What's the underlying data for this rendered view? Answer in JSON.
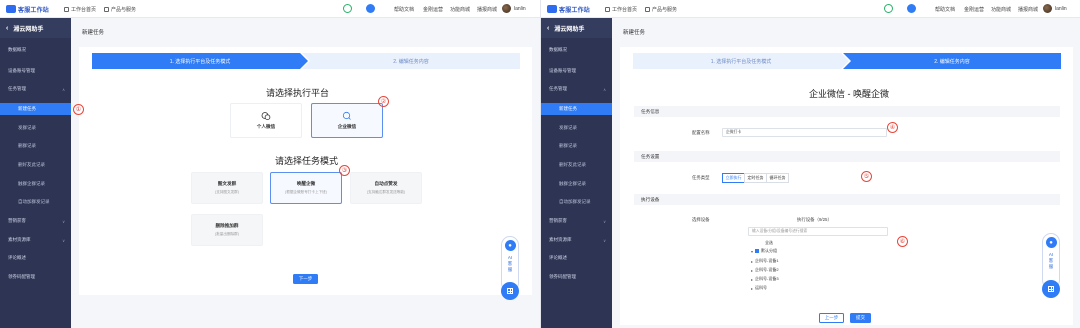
{
  "topbar": {
    "logo_text": "客服工作站",
    "links": [
      "工作台首页",
      "产品与服务"
    ],
    "right_links": [
      "帮助文档",
      "金刚运营",
      "功能商城",
      "播报商城"
    ],
    "user_name": "lanlin"
  },
  "sidebar": {
    "title": "湘云网助手",
    "items": [
      {
        "label": "数据概况"
      },
      {
        "label": "设备账号管理"
      },
      {
        "label": "任务管理"
      },
      {
        "label": "新建任务"
      },
      {
        "label": "发群记录"
      },
      {
        "label": "删群记录"
      },
      {
        "label": "删好友此记录"
      },
      {
        "label": "触群企群记录"
      },
      {
        "label": "自动加群发记录"
      },
      {
        "label": "营销获客"
      },
      {
        "label": "素材资源库"
      },
      {
        "label": "评论概述"
      },
      {
        "label": "领券码配管理"
      }
    ]
  },
  "left": {
    "page_title": "新建任务",
    "steps": [
      "1. 选择执行平台及任务模式",
      "2. 编辑任务内容"
    ],
    "platform_title": "请选择执行平台",
    "platforms": [
      {
        "name": "个人微信"
      },
      {
        "name": "企业微信"
      }
    ],
    "mode_title": "请选择任务模式",
    "modes": [
      {
        "name": "图文发群",
        "desc": "(支持图文发群)"
      },
      {
        "name": "唤醒企微",
        "desc": "(根据企微账号打卡上下班)"
      },
      {
        "name": "自动点赞发",
        "desc": "(支持触达群发发送等能)"
      },
      {
        "name": "删除推加群",
        "desc": "(批量出删除群)"
      }
    ],
    "next_label": "下一步",
    "markers": [
      "①",
      "②",
      "③"
    ]
  },
  "right": {
    "page_title": "新建任务",
    "steps": [
      "1. 选择执行平台及任务模式",
      "2. 编辑任务内容"
    ],
    "heading": "企业微信 - 唤醒企微",
    "sections": {
      "info": "任务信息",
      "settings": "任务设置",
      "exec": "执行设备"
    },
    "name_label": "配置名称",
    "name_value": "企微打卡",
    "type_label": "任务类型",
    "type_options": [
      "立即执行",
      "定时任务",
      "循环任务"
    ],
    "device_label": "选择设备",
    "device_count": "执行设备（9/25）",
    "device_placeholder": "输入设备/分组/设备编号进行搜索",
    "tree": {
      "root": "全选",
      "group": "默认分组",
      "items": [
        "企科号-设备1",
        "企科号-设备2",
        "企科号-设备3",
        "运科号"
      ]
    },
    "prev_label": "上一步",
    "submit_label": "提交",
    "markers": [
      "④",
      "⑤",
      "⑥"
    ]
  },
  "float": {
    "ai_label": "AI客服"
  },
  "colors": {
    "primary": "#2f7cf6",
    "sidebar": "#2d3454",
    "marker": "#e8473b"
  }
}
